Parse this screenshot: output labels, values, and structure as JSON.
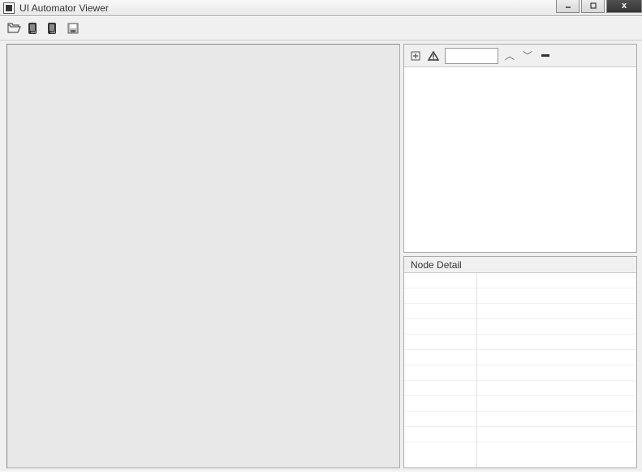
{
  "window": {
    "title": "UI Automator Viewer"
  },
  "toolbar": {
    "open_label": "Open",
    "device_screenshot_label": "Device Screenshot",
    "device_screenshot_compressed_label": "Device Screenshot (Compressed)",
    "save_label": "Save"
  },
  "tree": {
    "expand_all_label": "Expand All",
    "naf_filter_label": "Toggle NAF",
    "search_value": "",
    "search_placeholder": "",
    "prev_label": "Previous",
    "next_label": "Next",
    "clear_label": "Clear"
  },
  "detail": {
    "header": "Node Detail",
    "rows": [
      {
        "key": "",
        "value": ""
      },
      {
        "key": "",
        "value": ""
      },
      {
        "key": "",
        "value": ""
      },
      {
        "key": "",
        "value": ""
      },
      {
        "key": "",
        "value": ""
      },
      {
        "key": "",
        "value": ""
      },
      {
        "key": "",
        "value": ""
      },
      {
        "key": "",
        "value": ""
      },
      {
        "key": "",
        "value": ""
      },
      {
        "key": "",
        "value": ""
      },
      {
        "key": "",
        "value": ""
      }
    ]
  }
}
